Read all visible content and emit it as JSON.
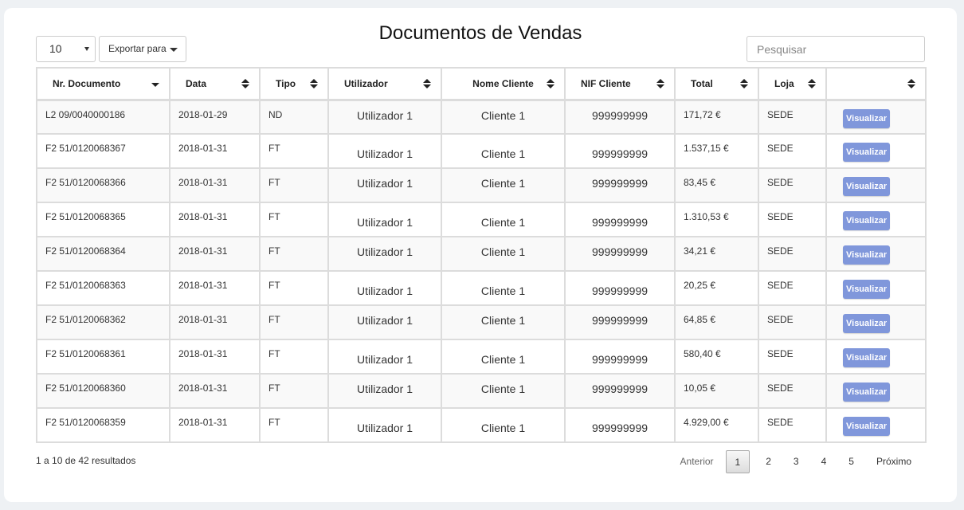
{
  "title": "Documentos de Vendas",
  "controls": {
    "page_length": "10",
    "export_label": "Exportar para",
    "search_placeholder": "Pesquisar"
  },
  "columns": [
    "Nr. Documento",
    "Data",
    "Tipo",
    "Utilizador",
    "Nome Cliente",
    "NIF Cliente",
    "Total",
    "Loja",
    ""
  ],
  "rows": [
    {
      "doc": "L2 09/0040000186",
      "date": "2018-01-29",
      "type": "ND",
      "user": "Utilizador 1",
      "client": "Cliente 1",
      "nif": "999999999",
      "total": "171,72 €",
      "store": "SEDE",
      "action": "Visualizar"
    },
    {
      "doc": "F2 51/0120068367",
      "date": "2018-01-31",
      "type": "FT",
      "user": "Utilizador 1",
      "client": "Cliente 1",
      "nif": "999999999",
      "total": "1.537,15 €",
      "store": "SEDE",
      "action": "Visualizar"
    },
    {
      "doc": "F2 51/0120068366",
      "date": "2018-01-31",
      "type": "FT",
      "user": "Utilizador 1",
      "client": "Cliente 1",
      "nif": "999999999",
      "total": "83,45 €",
      "store": "SEDE",
      "action": "Visualizar"
    },
    {
      "doc": "F2 51/0120068365",
      "date": "2018-01-31",
      "type": "FT",
      "user": "Utilizador 1",
      "client": "Cliente 1",
      "nif": "999999999",
      "total": "1.310,53 €",
      "store": "SEDE",
      "action": "Visualizar"
    },
    {
      "doc": "F2 51/0120068364",
      "date": "2018-01-31",
      "type": "FT",
      "user": "Utilizador 1",
      "client": "Cliente 1",
      "nif": "999999999",
      "total": "34,21 €",
      "store": "SEDE",
      "action": "Visualizar"
    },
    {
      "doc": "F2 51/0120068363",
      "date": "2018-01-31",
      "type": "FT",
      "user": "Utilizador 1",
      "client": "Cliente 1",
      "nif": "999999999",
      "total": "20,25 €",
      "store": "SEDE",
      "action": "Visualizar"
    },
    {
      "doc": "F2 51/0120068362",
      "date": "2018-01-31",
      "type": "FT",
      "user": "Utilizador 1",
      "client": "Cliente 1",
      "nif": "999999999",
      "total": "64,85 €",
      "store": "SEDE",
      "action": "Visualizar"
    },
    {
      "doc": "F2 51/0120068361",
      "date": "2018-01-31",
      "type": "FT",
      "user": "Utilizador 1",
      "client": "Cliente 1",
      "nif": "999999999",
      "total": "580,40 €",
      "store": "SEDE",
      "action": "Visualizar"
    },
    {
      "doc": "F2 51/0120068360",
      "date": "2018-01-31",
      "type": "FT",
      "user": "Utilizador 1",
      "client": "Cliente 1",
      "nif": "999999999",
      "total": "10,05 €",
      "store": "SEDE",
      "action": "Visualizar"
    },
    {
      "doc": "F2 51/0120068359",
      "date": "2018-01-31",
      "type": "FT",
      "user": "Utilizador 1",
      "client": "Cliente 1",
      "nif": "999999999",
      "total": "4.929,00 €",
      "store": "SEDE",
      "action": "Visualizar"
    }
  ],
  "footer": {
    "info": "1 a 10 de 42 resultados",
    "prev": "Anterior",
    "next": "Próximo",
    "pages": [
      "1",
      "2",
      "3",
      "4",
      "5"
    ]
  },
  "colors": {
    "accent_button": "#8097db",
    "border": "#dcdcdc",
    "stripe": "#f9f9f9"
  }
}
